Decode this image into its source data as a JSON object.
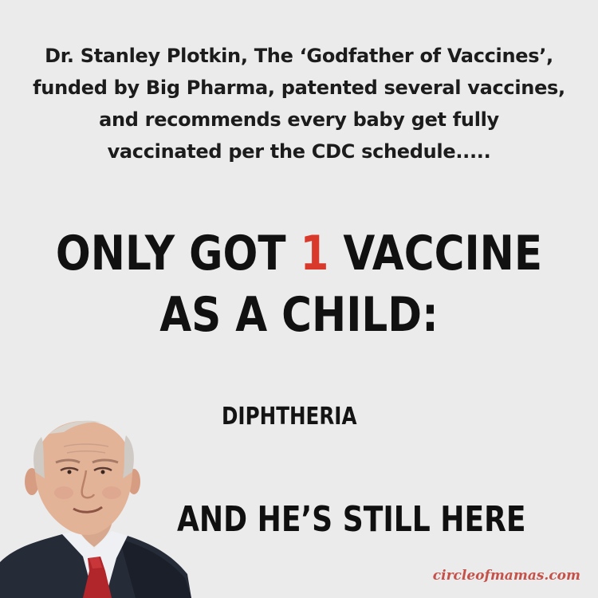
{
  "intro": {
    "line1": "Dr. Stanley Plotkin, The ‘Godfather of Vaccines’,",
    "line2": "funded by Big Pharma, patented several vaccines,",
    "line3": "and recommends every baby get fully",
    "line4": "vaccinated per the CDC schedule....."
  },
  "headline": {
    "before_number": "ONLY GOT ",
    "number": "1",
    "after_number": " VACCINE",
    "line2": "AS A CHILD:"
  },
  "vaccine_name": "DIPHTHERIA",
  "tagline": "AND HE’S STILL HERE",
  "watermark": "circleofmamas.com",
  "colors": {
    "background": "#ebebeb",
    "text": "#111111",
    "accent": "#d9392b",
    "watermark": "#c4524a"
  }
}
